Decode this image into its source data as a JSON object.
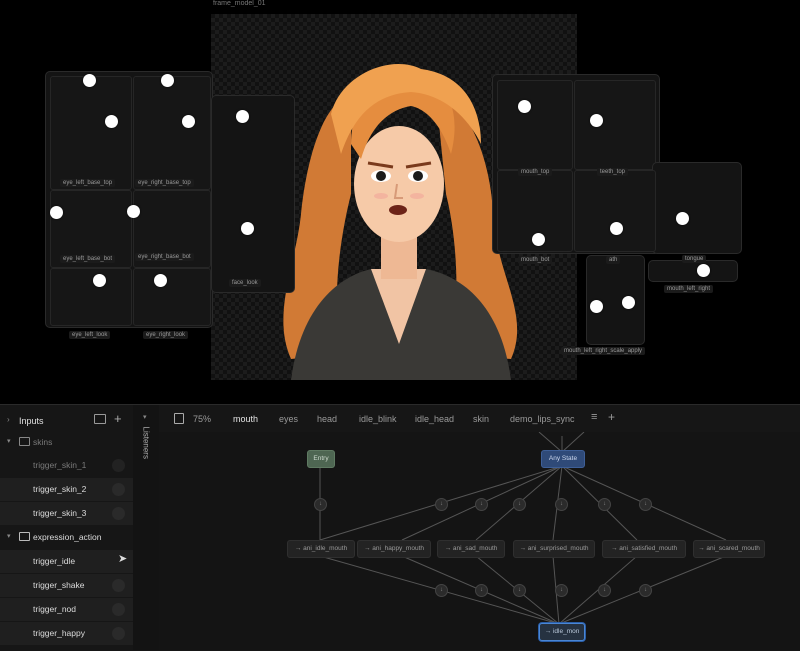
{
  "artboard": {
    "name": "frame_model_01"
  },
  "rig_labels": {
    "eye_left_base_top": "eye_left_base_top",
    "eye_right_base_top": "eye_right_base_top",
    "eye_left_base_bot": "eye_left_base_bot",
    "eye_right_base_bot": "eye_right_base_bot",
    "eye_left_look": "eye_left_look",
    "eye_right_look": "eye_right_look",
    "face_look": "face_look",
    "mouth_top": "mouth_top",
    "teeth_top": "teeth_top",
    "mouth_bot": "mouth_bot",
    "ath": "ath",
    "tongue": "tongue",
    "mouth_left_right": "mouth_left_right",
    "mouth_left_right_scale": "mouth_left_right_scale_apply"
  },
  "inputs": {
    "title": "Inputs",
    "groups": [
      {
        "label": "skins",
        "items": [
          "trigger_skin_1",
          "trigger_skin_2",
          "trigger_skin_3"
        ]
      },
      {
        "label": "expression_action",
        "items": [
          "trigger_idle",
          "trigger_shake",
          "trigger_nod",
          "trigger_happy"
        ]
      }
    ]
  },
  "listeners": {
    "label": "Listeners"
  },
  "toolbar": {
    "zoom": "75%"
  },
  "tabs": [
    "mouth",
    "eyes",
    "head",
    "idle_blink",
    "idle_head",
    "skin",
    "demo_lips_sync"
  ],
  "graph": {
    "entry": "Entry",
    "any_state": "Any State",
    "states": [
      "→ ani_idle_mouth",
      "→ ani_happy_mouth",
      "→ ani_sad_mouth",
      "→ ani_surprised_mouth",
      "→ ani_satisfied_mouth",
      "→ ani_scared_mouth"
    ],
    "exit": "→ idle_mon"
  },
  "colors": {
    "accent": "#3b6fb5",
    "entry": "#4e6652",
    "any_state": "#2f4a78"
  }
}
